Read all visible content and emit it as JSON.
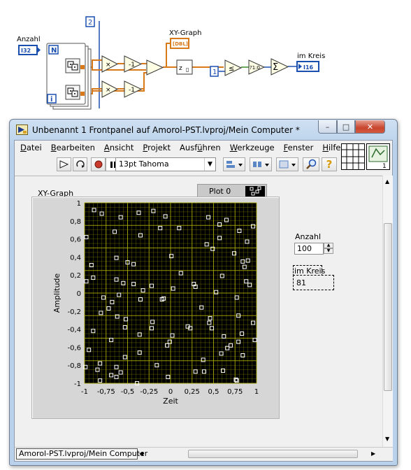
{
  "block_diagram": {
    "anzahl_label": "Anzahl",
    "anzahl_terminal": "I32",
    "loop_count": "N",
    "loop_iteration": "i",
    "const_two": "2",
    "const_one": "1",
    "xy_graph_label": "XY-Graph",
    "xy_graph_terminal": "[DBL]",
    "compare_label": "?1:0",
    "im_kreis_label": "im Kreis",
    "im_kreis_terminal": "I16"
  },
  "window": {
    "title": "Unbenannt 1 Frontpanel auf Amorol-PST.lvproj/Mein Computer *",
    "buttons": {
      "minimize": "–",
      "maximize": "□",
      "close": "✕"
    }
  },
  "menu": {
    "items": [
      {
        "hot": "D",
        "rest": "atei"
      },
      {
        "hot": "B",
        "rest": "earbeiten"
      },
      {
        "hot": "A",
        "rest": "nsicht"
      },
      {
        "hot": "P",
        "rest": "rojekt"
      },
      {
        "hot": "",
        "rest": "Ausf",
        "hot2": "ü",
        "rest2": "hren"
      },
      {
        "hot": "W",
        "rest": "erkzeuge"
      },
      {
        "hot": "F",
        "rest": "enster"
      },
      {
        "hot": "H",
        "rest": "ilfe"
      }
    ]
  },
  "toolbar": {
    "font_select": "13pt Tahoma",
    "icons": [
      "run-arrow-icon",
      "run-continuous-icon",
      "abort-icon",
      "pause-icon",
      "align-icon",
      "distribute-icon",
      "resize-icon",
      "search-icon",
      "help-icon"
    ]
  },
  "front_panel": {
    "graph_label": "XY-Graph",
    "plot_legend": "Plot 0",
    "anzahl_label": "Anzahl",
    "anzahl_value": "100",
    "im_kreis_label": "im Kreis",
    "im_kreis_value": "81"
  },
  "status": {
    "project": "Amorol-PST.lvproj/Mein Computer"
  },
  "chart_data": {
    "type": "scatter",
    "title": "",
    "xlabel": "Zeit",
    "ylabel": "Amplitude",
    "xlim": [
      -1,
      1
    ],
    "ylim": [
      -1,
      1
    ],
    "x_ticks": [
      "-1",
      "-0,75",
      "-0,5",
      "-0,25",
      "0",
      "0,25",
      "0,5",
      "0,75",
      "1"
    ],
    "y_ticks": [
      "1",
      "0,8",
      "0,6",
      "0,4",
      "0,2",
      "0",
      "-0,2",
      "-0,4",
      "-0,6",
      "-0,8",
      "-1"
    ],
    "grid": true,
    "colors": {
      "background": "#000000",
      "grid": "#a8a800",
      "points": "#ffffff"
    },
    "series": [
      {
        "marker": "hollow-square",
        "x": [
          -0.89,
          -0.8,
          -0.58,
          -0.37,
          -0.2,
          -0.06,
          0.1,
          0.44,
          0.57,
          0.65,
          0.8,
          0.96,
          -0.98,
          -0.65,
          -0.35,
          -0.12,
          0.42,
          0.49,
          0.57,
          0.74,
          0.89,
          -0.92,
          -0.63,
          -0.5,
          -0.43,
          0.01,
          0.84,
          0.86,
          0.9,
          -0.9,
          -0.63,
          -0.55,
          -0.43,
          -0.22,
          0.12,
          0.6,
          0.88,
          0.92,
          -0.98,
          -0.78,
          -0.68,
          -0.6,
          -0.35,
          -0.32,
          0.03,
          0.27,
          0.29,
          0.53,
          0.77,
          -0.81,
          -0.72,
          -0.62,
          -0.52,
          -0.21,
          -0.1,
          -0.08,
          0.36,
          0.46,
          0.79,
          0.96,
          -0.9,
          -0.53,
          -0.36,
          -0.22,
          0.02,
          0.45,
          0.48,
          0.62,
          0.83,
          -0.69,
          -0.01,
          0.2,
          0.23,
          0.98,
          -0.95,
          -0.53,
          -0.36,
          -0.04,
          0.59,
          0.7,
          0.79,
          -0.82,
          -0.63,
          0.38,
          0.66,
          0.84,
          -0.85,
          -0.69,
          -0.58,
          -0.16,
          0.39,
          0.61,
          0.76,
          -0.99,
          -0.82,
          -0.63,
          -0.39,
          -0.03,
          0.29,
          0.77
        ],
        "y": [
          0.92,
          0.88,
          0.84,
          0.89,
          0.91,
          0.85,
          0.72,
          0.84,
          0.76,
          0.81,
          0.69,
          0.74,
          0.62,
          0.68,
          0.64,
          0.72,
          0.54,
          0.49,
          0.61,
          0.44,
          0.57,
          0.31,
          0.39,
          0.34,
          0.32,
          0.41,
          0.35,
          0.29,
          0.36,
          0.17,
          0.15,
          0.11,
          0.1,
          0.08,
          0.22,
          0.19,
          0.13,
          0.09,
          0.13,
          -0.05,
          -0.1,
          -0.02,
          -0.07,
          0.03,
          0.05,
          0.1,
          0.07,
          0.01,
          -0.05,
          -0.22,
          -0.17,
          -0.26,
          -0.29,
          -0.32,
          -0.07,
          -0.06,
          -0.16,
          -0.28,
          -0.25,
          -0.33,
          -0.42,
          -0.38,
          -0.46,
          -0.39,
          -0.47,
          -0.33,
          -0.39,
          -0.48,
          -0.45,
          -0.52,
          -0.54,
          -0.37,
          -0.39,
          -0.52,
          -0.63,
          -0.71,
          -0.66,
          -0.58,
          -0.67,
          -0.58,
          -0.54,
          -0.78,
          -0.82,
          -0.74,
          -0.61,
          -0.69,
          -0.85,
          -0.91,
          -0.88,
          -0.8,
          -0.87,
          -0.86,
          -0.96,
          -0.82,
          -0.97,
          -0.93,
          -1.0,
          -0.93,
          -0.87,
          -0.97
        ]
      }
    ]
  }
}
